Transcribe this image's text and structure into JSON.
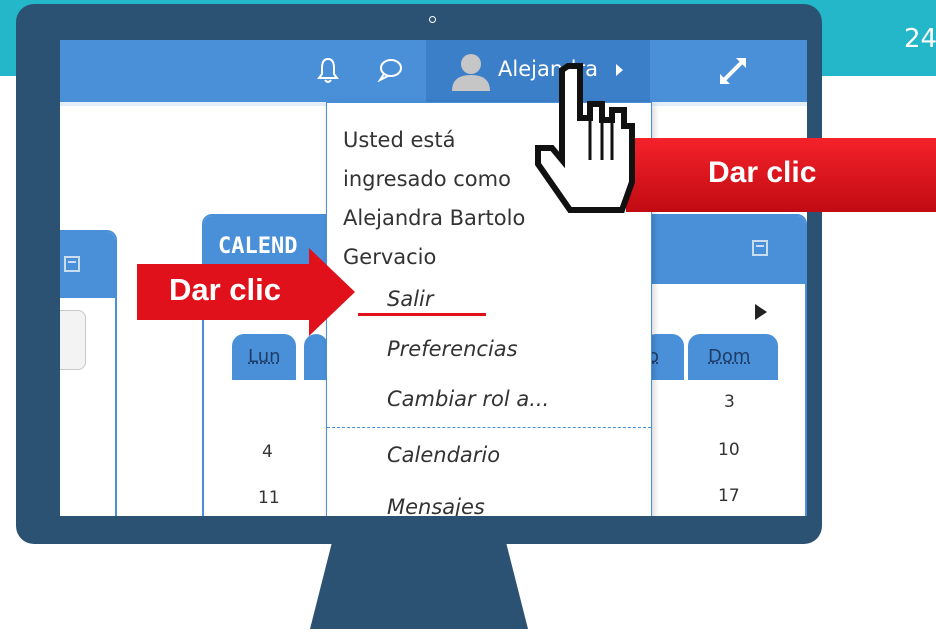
{
  "slide": {
    "page_number": "24"
  },
  "navbar": {
    "user_name": "Alejandra",
    "notifications_icon": "bell-icon",
    "messages_icon": "chat-bubble-icon",
    "fullscreen_icon": "expand-arrows-icon"
  },
  "dropdown": {
    "info_lines": [
      "Usted está",
      "ingresado como",
      "Alejandra Bartolo",
      "Gervacio"
    ],
    "items": [
      {
        "label": "Salir"
      },
      {
        "label": "Preferencias"
      },
      {
        "label": "Cambiar rol a..."
      },
      {
        "label": "Calendario"
      },
      {
        "label": "Mensajes"
      }
    ]
  },
  "calendar": {
    "title": "CALEND",
    "day_headers": [
      "Lun",
      "o",
      "Dom"
    ],
    "rows": [
      {
        "first": "",
        "last": "3"
      },
      {
        "first": "4",
        "last": "10"
      },
      {
        "first": "11",
        "last": "17"
      }
    ]
  },
  "annotations": {
    "callout_right": "Dar clic",
    "callout_left": "Dar clic"
  },
  "colors": {
    "slide_band": "#23b7c9",
    "monitor": "#2b5273",
    "navbar": "#4a90d9",
    "callout": "#e0111a"
  }
}
